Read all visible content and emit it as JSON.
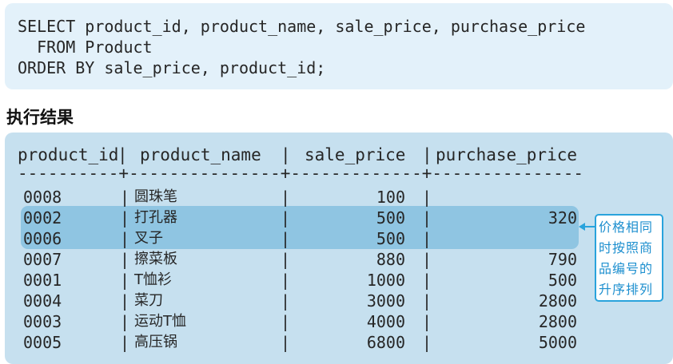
{
  "sql": {
    "line1": "SELECT product_id, product_name, sale_price, purchase_price",
    "line2": "  FROM Product",
    "line3": "ORDER BY sale_price, product_id;"
  },
  "section_title": "执行结果",
  "table": {
    "headers": [
      "product_id",
      "product_name",
      "sale_price",
      "purchase_price"
    ],
    "separator": "----------+---------------+-------------+---------------",
    "rows": [
      {
        "product_id": "0008",
        "product_name": "圆珠笔",
        "sale_price": "100",
        "purchase_price": "",
        "highlighted": false
      },
      {
        "product_id": "0002",
        "product_name": "打孔器",
        "sale_price": "500",
        "purchase_price": "320",
        "highlighted": true
      },
      {
        "product_id": "0006",
        "product_name": "叉子",
        "sale_price": "500",
        "purchase_price": "",
        "highlighted": true
      },
      {
        "product_id": "0007",
        "product_name": "擦菜板",
        "sale_price": "880",
        "purchase_price": "790",
        "highlighted": false
      },
      {
        "product_id": "0001",
        "product_name": "T恤衫",
        "sale_price": "1000",
        "purchase_price": "500",
        "highlighted": false
      },
      {
        "product_id": "0004",
        "product_name": "菜刀",
        "sale_price": "3000",
        "purchase_price": "2800",
        "highlighted": false
      },
      {
        "product_id": "0003",
        "product_name": "运动T恤",
        "sale_price": "4000",
        "purchase_price": "2800",
        "highlighted": false
      },
      {
        "product_id": "0005",
        "product_name": "高压锅",
        "sale_price": "6800",
        "purchase_price": "5000",
        "highlighted": false
      }
    ]
  },
  "callout": {
    "text": "价格相同时按照商品编号的升序排列"
  },
  "colors": {
    "code_bg": "#e3f1fa",
    "result_bg": "#c6e0ef",
    "highlight": "#8fc5e2",
    "callout_accent": "#29a3dc"
  }
}
